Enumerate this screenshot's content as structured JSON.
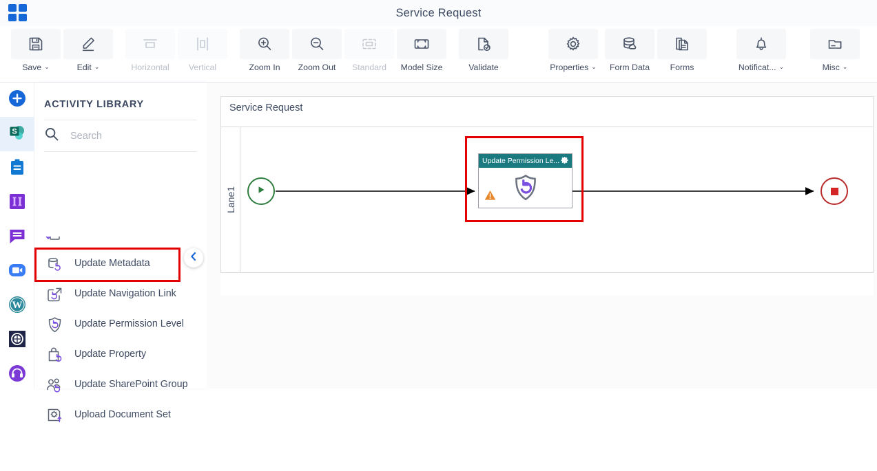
{
  "window": {
    "title": "Service Request",
    "app_launcher_icon": "grid-apps-icon"
  },
  "ribbon": {
    "buttons": [
      {
        "id": "save",
        "label": "Save",
        "icon": "floppy-disk-icon",
        "dropdown": true,
        "disabled": false
      },
      {
        "id": "edit",
        "label": "Edit",
        "icon": "pencil-icon",
        "dropdown": true,
        "disabled": false
      },
      {
        "id": "horizontal",
        "label": "Horizontal",
        "icon": "align-horizontal-icon",
        "dropdown": false,
        "disabled": true
      },
      {
        "id": "vertical",
        "label": "Vertical",
        "icon": "align-vertical-icon",
        "dropdown": false,
        "disabled": true
      },
      {
        "id": "zoom-in",
        "label": "Zoom In",
        "icon": "magnifier-plus-icon",
        "dropdown": false,
        "disabled": false
      },
      {
        "id": "zoom-out",
        "label": "Zoom Out",
        "icon": "magnifier-minus-icon",
        "dropdown": false,
        "disabled": false
      },
      {
        "id": "standard",
        "label": "Standard",
        "icon": "fit-standard-icon",
        "dropdown": false,
        "disabled": true
      },
      {
        "id": "model-size",
        "label": "Model Size",
        "icon": "fit-model-size-icon",
        "dropdown": false,
        "disabled": false
      },
      {
        "id": "validate",
        "label": "Validate",
        "icon": "document-check-icon",
        "dropdown": false,
        "disabled": false
      },
      {
        "id": "properties",
        "label": "Properties",
        "icon": "gear-icon",
        "dropdown": true,
        "disabled": false
      },
      {
        "id": "form-data",
        "label": "Form Data",
        "icon": "database-cloud-icon",
        "dropdown": false,
        "disabled": false
      },
      {
        "id": "forms",
        "label": "Forms",
        "icon": "documents-icon",
        "dropdown": false,
        "disabled": false
      },
      {
        "id": "notifications",
        "label": "Notificat...",
        "icon": "bell-icon",
        "dropdown": true,
        "disabled": false
      },
      {
        "id": "misc",
        "label": "Misc",
        "icon": "folder-card-icon",
        "dropdown": true,
        "disabled": false
      }
    ],
    "dropdown_glyph": "⌄"
  },
  "rail": {
    "items": [
      {
        "id": "add",
        "icon": "plus-circle-icon",
        "selected": false
      },
      {
        "id": "sharepoint",
        "icon": "sharepoint-icon",
        "selected": true
      },
      {
        "id": "tasks",
        "icon": "clipboard-icon",
        "selected": false
      },
      {
        "id": "columns",
        "icon": "two-columns-icon",
        "selected": false
      },
      {
        "id": "messages",
        "icon": "chat-bubble-icon",
        "selected": false
      },
      {
        "id": "zoom-meet",
        "icon": "video-camera-icon",
        "selected": false
      },
      {
        "id": "wordpress",
        "icon": "wordpress-icon",
        "selected": false
      },
      {
        "id": "integration",
        "icon": "dark-circle-icon",
        "selected": false
      },
      {
        "id": "support",
        "icon": "headset-icon",
        "selected": false
      }
    ]
  },
  "library": {
    "title": "ACTIVITY LIBRARY",
    "search": {
      "value": "",
      "placeholder": "Search",
      "icon": "search-icon"
    },
    "collapse_button": {
      "icon": "chevron-left-icon",
      "color": "#1667d8"
    },
    "highlight_color": "#e40000",
    "items": [
      {
        "label": "",
        "icon": "update-list-item-icon",
        "clipped": true,
        "selected": false
      },
      {
        "label": "Update Metadata",
        "icon": "database-refresh-icon",
        "clipped": false,
        "selected": false
      },
      {
        "label": "Update Navigation Link",
        "icon": "link-refresh-icon",
        "clipped": false,
        "selected": false
      },
      {
        "label": "Update Permission Level",
        "icon": "shield-refresh-icon",
        "clipped": false,
        "selected": true
      },
      {
        "label": "Update Property",
        "icon": "bag-refresh-icon",
        "clipped": false,
        "selected": false
      },
      {
        "label": "Update SharePoint Group",
        "icon": "users-refresh-icon",
        "clipped": false,
        "selected": false
      },
      {
        "label": "Upload Document Set",
        "icon": "document-upload-icon",
        "clipped": false,
        "selected": false
      }
    ]
  },
  "canvas": {
    "pool_title": "Service Request",
    "lane_label": "Lane1",
    "start_node": {
      "icon": "play-triangle-icon",
      "color": "#2f7d3e"
    },
    "end_node": {
      "icon": "stop-square-icon",
      "color": "#b92b2b"
    },
    "task": {
      "title": "Update Permission Le...",
      "header_color": "#1a7a80",
      "settings_icon": "gear-icon",
      "activity_icon": "shield-refresh-icon",
      "warning_icon": "warning-triangle-icon",
      "warning_color": "#e8882a",
      "selection_color": "#e40000"
    }
  }
}
